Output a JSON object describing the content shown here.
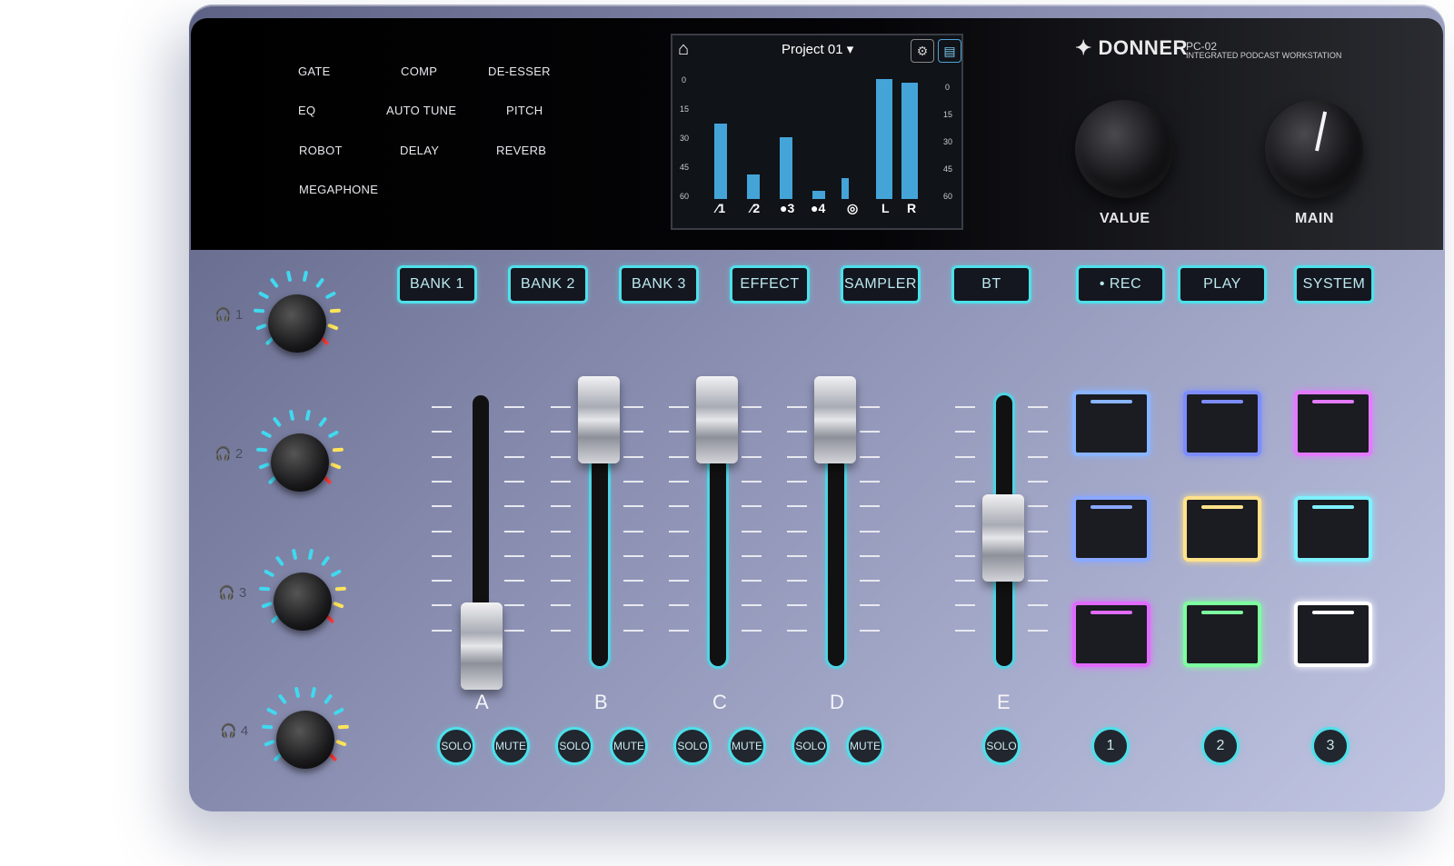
{
  "effects": [
    "GATE",
    "COMP",
    "DE-ESSER",
    "EQ",
    "AUTO TUNE",
    "PITCH",
    "ROBOT",
    "DELAY",
    "REVERB",
    "MEGAPHONE"
  ],
  "screen": {
    "home_icon": "home-icon",
    "project": "Project 01 ▾",
    "scale_left": [
      "0",
      "15",
      "30",
      "45",
      "60"
    ],
    "scale_right": [
      "0",
      "15",
      "30",
      "45",
      "60"
    ],
    "channels": [
      "1",
      "2",
      "3",
      "4",
      "L",
      "R"
    ],
    "meter_levels": [
      0.55,
      0.18,
      0.45,
      0.06,
      0.15,
      0.88,
      0.85
    ]
  },
  "brand": {
    "name": "DONNER",
    "model": "PC-02",
    "subtitle": "INTEGRATED PODCAST WORKSTATION"
  },
  "big_knobs": [
    "VALUE",
    "MAIN"
  ],
  "mode_buttons": [
    "BANK 1",
    "BANK 2",
    "BANK 3",
    "EFFECT",
    "SAMPLER",
    "BT",
    "• REC",
    "PLAY",
    "SYSTEM"
  ],
  "headphones": [
    "1",
    "2",
    "3",
    "4"
  ],
  "channels": [
    "A",
    "B",
    "C",
    "D",
    "E"
  ],
  "solo": "SOLO",
  "mute": "MUTE",
  "pad_numbers": [
    "1",
    "2",
    "3"
  ],
  "colors": {
    "accent": "#4fe0ea",
    "meter": "#44a4d8"
  },
  "pads": [
    "#8ab4ff",
    "#7d8dff",
    "#e27bff",
    "#8aa8ff",
    "#ffe28a",
    "#7ff0ff",
    "#e06bff",
    "#7dffa0",
    "#ffffff"
  ]
}
